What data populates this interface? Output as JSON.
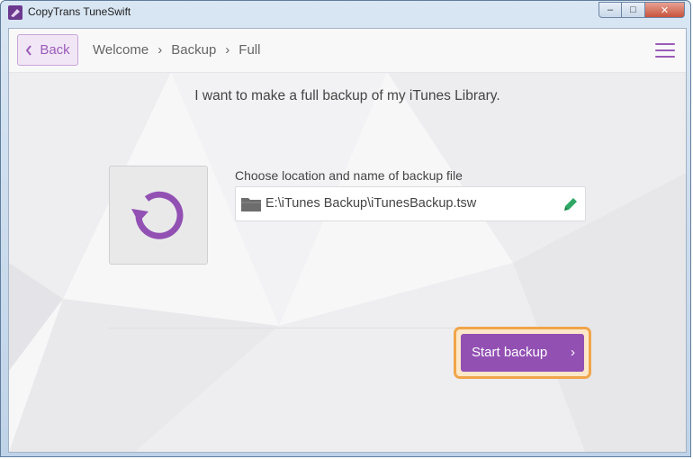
{
  "window": {
    "title": "CopyTrans TuneSwift",
    "controls": {
      "minimize": "‒",
      "maximize": "□",
      "close": "✕"
    }
  },
  "nav": {
    "back_label": "Back",
    "breadcrumb": [
      "Welcome",
      "›",
      "Backup",
      "›",
      "Full"
    ]
  },
  "main": {
    "heading": "I want to make a full backup of my iTunes Library.",
    "location_label": "Choose location and name of backup file",
    "path_value": "E:\\iTunes Backup\\iTunesBackup.tsw",
    "start_label": "Start backup",
    "start_chevron": "›"
  },
  "colors": {
    "accent": "#9250b3",
    "highlight": "#f0a54a",
    "edit": "#2fa866"
  },
  "icons": [
    "app-icon",
    "back-chevron-icon",
    "menu-icon",
    "restore-icon",
    "folder-icon",
    "pencil-icon",
    "chevron-right-icon"
  ]
}
